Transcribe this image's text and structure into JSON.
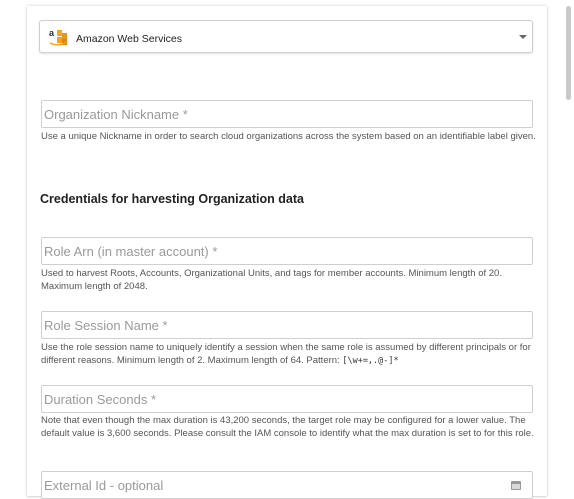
{
  "provider_select": {
    "logo_text": "a",
    "value": "Amazon Web Services"
  },
  "nickname": {
    "placeholder": "Organization Nickname *",
    "help": "Use a unique Nickname in order to search cloud organizations across the system based on an identifiable label given."
  },
  "credentials_heading": "Credentials for harvesting Organization data",
  "role_arn": {
    "placeholder": "Role Arn (in master account) *",
    "help": "Used to harvest Roots, Accounts, Organizational Units, and tags for member accounts. Minimum length of 20. Maximum length of 2048."
  },
  "role_session_name": {
    "placeholder": "Role Session Name *",
    "help": "Use the role session name to uniquely identify a session when the same role is assumed by different principals or for different reasons. Minimum length of 2. Maximum length of 64. Pattern: ",
    "pattern": "[\\w+=,.@-]*"
  },
  "duration_seconds": {
    "placeholder": "Duration Seconds *",
    "help": "Note that even though the max duration is 43,200 seconds, the target role may be configured for a lower value. The default value is 3,600 seconds. Please consult the IAM console to identify what the max duration is set to for this role."
  },
  "external_id": {
    "placeholder": "External Id - optional"
  },
  "colors": {
    "aws_orange": "#f7a31c",
    "aws_dark": "#232f3e"
  }
}
